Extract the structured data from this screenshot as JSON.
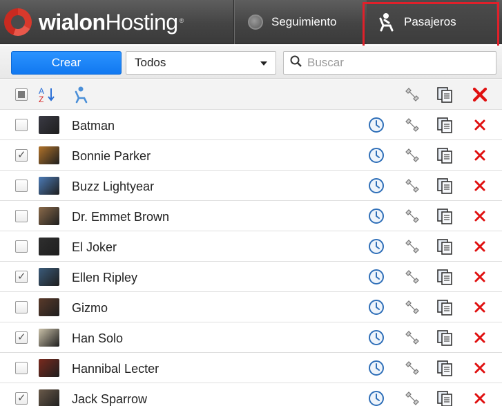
{
  "app": {
    "brand_bold": "wialon",
    "brand_thin": "Hosting",
    "brand_sub": "®",
    "accent": "#1a85ff",
    "delete_color": "#e01010"
  },
  "tabs": [
    {
      "label": "Seguimiento",
      "icon": "globe-icon",
      "active": false
    },
    {
      "label": "Pasajeros",
      "icon": "passenger-icon",
      "active": true
    }
  ],
  "toolbar": {
    "create_label": "Crear",
    "filter_value": "Todos",
    "search_placeholder": "Buscar"
  },
  "list_header": {
    "icons": [
      "select-all-icon",
      "sort-az-icon",
      "passenger-icon",
      "wrench-icon",
      "copy-icon",
      "delete-icon"
    ]
  },
  "passengers": [
    {
      "name": "Batman",
      "checked": false,
      "thumb": "#3a3a44"
    },
    {
      "name": "Bonnie Parker",
      "checked": true,
      "thumb": "#b0722a"
    },
    {
      "name": "Buzz Lightyear",
      "checked": false,
      "thumb": "#4c7bb6"
    },
    {
      "name": "Dr. Emmet Brown",
      "checked": false,
      "thumb": "#8a6a4a"
    },
    {
      "name": "El Joker",
      "checked": false,
      "thumb": "#2f2f2f"
    },
    {
      "name": "Ellen Ripley",
      "checked": true,
      "thumb": "#3b5b7a"
    },
    {
      "name": "Gizmo",
      "checked": false,
      "thumb": "#5a3a2a"
    },
    {
      "name": "Han Solo",
      "checked": true,
      "thumb": "#c9c0a8"
    },
    {
      "name": "Hannibal Lecter",
      "checked": false,
      "thumb": "#7a2a1e"
    },
    {
      "name": "Jack Sparrow",
      "checked": true,
      "thumb": "#6a5a4a"
    }
  ]
}
